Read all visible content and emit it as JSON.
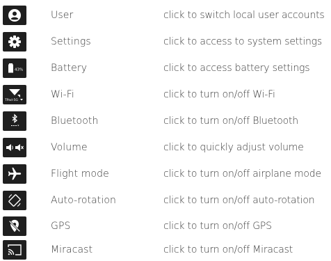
{
  "rows": [
    {
      "name": "User",
      "description": "click to switch local user accounts",
      "icon": "user-icon"
    },
    {
      "name": "Settings",
      "description": "click to access to system settings",
      "icon": "gear-icon"
    },
    {
      "name": "Battery",
      "description": "click to access battery settings",
      "icon": "battery-icon",
      "icon_text": "43%"
    },
    {
      "name": "Wi-Fi",
      "description": "click to turn on/off Wi-Fi",
      "icon": "wifi-icon",
      "icon_text": "TPad-5G"
    },
    {
      "name": "Bluetooth",
      "description": "click to turn on/off Bluetooth",
      "icon": "bluetooth-icon"
    },
    {
      "name": "Volume",
      "description": "click to quickly adjust volume",
      "icon": "volume-icon"
    },
    {
      "name": "Flight mode",
      "description": "click to turn on/off airplane mode",
      "icon": "airplane-icon"
    },
    {
      "name": "Auto-rotation",
      "description": "click to turn on/off auto-rotation",
      "icon": "rotation-icon"
    },
    {
      "name": "GPS",
      "description": "click to turn on/off GPS",
      "icon": "gps-off-icon"
    },
    {
      "name": "Miracast",
      "description": "click to turn on/off Miracast",
      "icon": "cast-icon"
    }
  ],
  "colors": {
    "icon_bg": "#1f1f1f",
    "text": "#3a3a3a"
  }
}
